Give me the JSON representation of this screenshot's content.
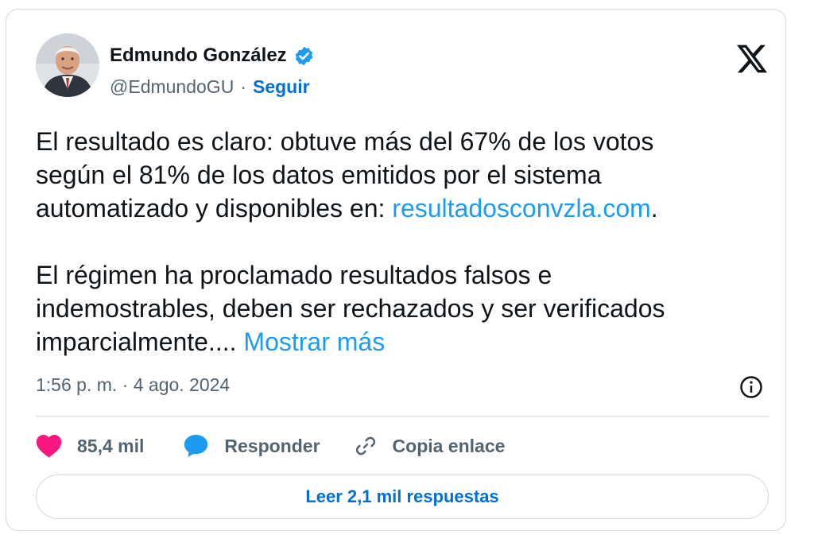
{
  "tweet": {
    "author_name": "Edmundo González",
    "handle": "@EdmundoGU",
    "separator": "·",
    "follow_label": "Seguir",
    "text_para1_a": "El resultado es claro: obtuve más del 67% de los votos\nsegún el 81% de los datos emitidos por el sistema\nautomatizado y disponibles en: ",
    "text_para1_link": "resultadosconvzla.com",
    "text_para1_end": ".",
    "text_para2_a": "El régimen ha proclamado resultados falsos e\nindemostrables, deben ser rechazados y ser verificados\nimparcialmente.... ",
    "show_more_label": "Mostrar más",
    "timestamp": "1:56 p. m. · 4 ago. 2024"
  },
  "actions": {
    "like_count": "85,4 mil",
    "reply_label": "Responder",
    "copy_label": "Copia enlace"
  },
  "read_replies_label": "Leer 2,1 mil respuestas",
  "icons": {
    "verified": "verified-badge-icon",
    "x_logo": "x-logo-icon",
    "info": "info-icon",
    "like": "heart-icon",
    "reply": "speech-bubble-icon",
    "copy": "link-icon"
  },
  "colors": {
    "accent": "#1d9bf0",
    "follow": "#006fd6",
    "like": "#f91880",
    "text": "#0f1419",
    "muted": "#536471",
    "border": "#cfd9de"
  }
}
